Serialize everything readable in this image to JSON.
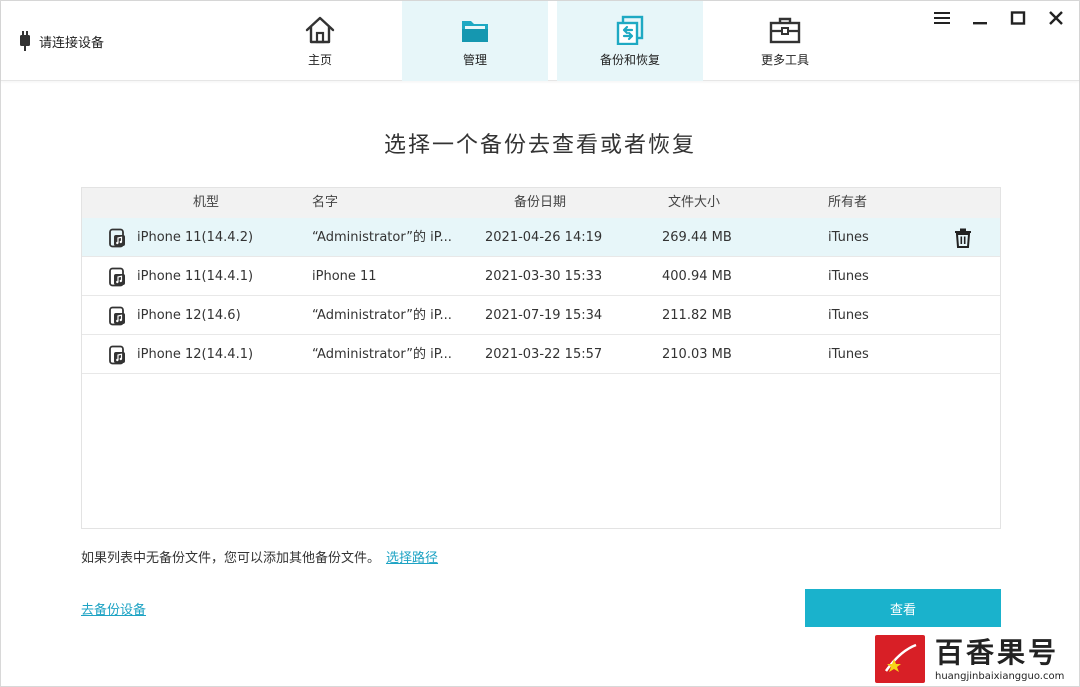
{
  "header": {
    "device_status": "请连接设备",
    "tabs": [
      {
        "label": "主页",
        "icon": "home-icon"
      },
      {
        "label": "管理",
        "icon": "folder-icon"
      },
      {
        "label": "备份和恢复",
        "icon": "backup-restore-icon"
      },
      {
        "label": "更多工具",
        "icon": "toolbox-icon"
      }
    ],
    "active_tabs": [
      "管理",
      "备份和恢复"
    ]
  },
  "main": {
    "title": "选择一个备份去查看或者恢复",
    "table": {
      "columns": [
        "机型",
        "名字",
        "备份日期",
        "文件大小",
        "所有者"
      ],
      "rows": [
        {
          "model": "iPhone 11(14.4.2)",
          "name": "“Administrator”的 iP...",
          "date": "2021-04-26 14:19",
          "size": "269.44 MB",
          "owner": "iTunes"
        },
        {
          "model": "iPhone 11(14.4.1)",
          "name": "iPhone 11",
          "date": "2021-03-30 15:33",
          "size": "400.94 MB",
          "owner": "iTunes"
        },
        {
          "model": "iPhone 12(14.6)",
          "name": "“Administrator”的 iP...",
          "date": "2021-07-19 15:34",
          "size": "211.82 MB",
          "owner": "iTunes"
        },
        {
          "model": "iPhone 12(14.4.1)",
          "name": "“Administrator”的 iP...",
          "date": "2021-03-22 15:57",
          "size": "210.03 MB",
          "owner": "iTunes"
        }
      ],
      "selected_row": 0
    },
    "hint_text": "如果列表中无备份文件，您可以添加其他备份文件。",
    "select_path_link": "选择路径",
    "go_backup_link": "去备份设备",
    "view_button": "查看"
  },
  "watermark": {
    "brand": "百香果号",
    "url": "huangjinbaixiangguo.com"
  },
  "colors": {
    "accent": "#1ab2cc",
    "active_tab_bg": "#e7f6f9",
    "selected_row_bg": "#e7f6f9",
    "link": "#1ea3c4",
    "watermark_red": "#d81f26"
  }
}
